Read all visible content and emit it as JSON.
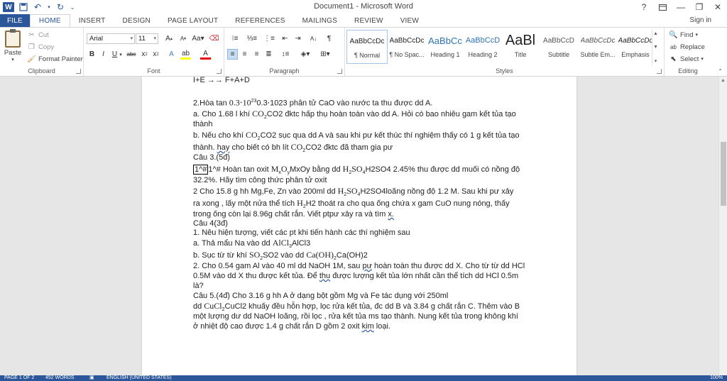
{
  "window": {
    "title": "Document1 - Microsoft Word",
    "help": "?",
    "sign_in": "Sign in"
  },
  "tabs": [
    "FILE",
    "HOME",
    "INSERT",
    "DESIGN",
    "PAGE LAYOUT",
    "REFERENCES",
    "MAILINGS",
    "REVIEW",
    "VIEW"
  ],
  "clipboard": {
    "paste": "Paste",
    "cut": "Cut",
    "copy": "Copy",
    "format_painter": "Format Painter",
    "label": "Clipboard"
  },
  "font": {
    "name": "Arial",
    "size": "11",
    "label": "Font"
  },
  "paragraph": {
    "label": "Paragraph"
  },
  "styles": {
    "label": "Styles",
    "items": [
      {
        "preview": "AaBbCcDc",
        "name": "¶ Normal"
      },
      {
        "preview": "AaBbCcDc",
        "name": "¶ No Spac..."
      },
      {
        "preview": "AaBbCc",
        "name": "Heading 1"
      },
      {
        "preview": "AaBbCcD",
        "name": "Heading 2"
      },
      {
        "preview": "AaBl",
        "name": "Title"
      },
      {
        "preview": "AaBbCcD",
        "name": "Subtitle"
      },
      {
        "preview": "AaBbCcDc",
        "name": "Subtle Em..."
      },
      {
        "preview": "AaBbCcDc",
        "name": "Emphasis"
      }
    ]
  },
  "editing": {
    "find": "Find",
    "replace": "Replace",
    "select": "Select",
    "label": "Editing"
  },
  "document": {
    "l1": "I+E →→ F+A+D",
    "l2a": "2.Hòa tan ",
    "l2m": "0.3⋅10",
    "l2s": "23",
    "l2b": "0.3⋅1023 phân tử CaO vào nước ta thu được dd A.",
    "l3a": "a. Cho 1.68 l khí ",
    "l3m": "CO",
    "l3s": "2",
    "l3b": "CO2 đktc hấp thụ hoàn toàn vào dd A. Hỏi có bao nhiêu gam kết tủa tạo",
    "l4": "thành",
    "l5a": "b. Nếu cho khí ",
    "l5m": "CO",
    "l5s": "2",
    "l5b": "CO2 sục qua dd A và sau khi pư kết thúc thí nghiệm thấy có 1 g kết tủa tạo",
    "l6a": "thành. ",
    "l6h": "hay",
    "l6b": " cho biết có bh lít ",
    "l6m": "CO",
    "l6s": "2",
    "l6c": "CO2 đktc đã tham gia pư",
    "l7": "Câu 3.(5đ)",
    "l8box": "1^#",
    "l8a": "1^# Hoàn tan oxit ",
    "l8m": "M",
    "l8s1": "x",
    "l8m2": "O",
    "l8s2": "y",
    "l8b": "MxOy bằng dd ",
    "l8m3": "H",
    "l8s3": "2",
    "l8m4": "SO",
    "l8s4": "4",
    "l8c": "H2SO4 2.45% thu được dd muối có nồng độ",
    "l9": "32.2%. Hãy tìm công thức phân tử oxit",
    "l10a": "2 Cho 15.8 g hh Mg,Fe, Zn vào 200ml dd ",
    "l10m": "H",
    "l10s": "2",
    "l10m2": "SO",
    "l10s2": "4",
    "l10b": "H2SO4loãng nồng độ 1.2 M. Sau khi pư xảy",
    "l11a": "ra xong , lấy một nửa thể tích ",
    "l11m": "H",
    "l11s": "2",
    "l11b": "H2 thoát ra cho qua ống chứa x gam CuO nung nóng, thấy",
    "l12a": "trong ống còn lại 8.96g chất rắn. Viết ptpư xảy ra và tìm ",
    "l12h": "x.",
    "l13": "Câu 4(3đ)",
    "l14": "1. Nêu hiện tượng, viết các pt khi tiến hành các thí nghiệm sau",
    "l15a": "a. Thả mẩu Na vào dd ",
    "l15m": "AlCl",
    "l15s": "3",
    "l15b": "AlCl3",
    "l16a": "b. Sục từ từ khí ",
    "l16m": "SO",
    "l16s": "2",
    "l16b": "SO2 vào dd ",
    "l16m2": "Ca(OH)",
    "l16s2": "2",
    "l16c": "Ca(OH)2",
    "l17a": "2. Cho 0.54 gam Al vào 40 ml dd NaOH 1M, sau ",
    "l17h": "pư",
    "l17b": " hoàn toàn thu được dd X. Cho từ từ dd HCl",
    "l18a": "0.5M vào dd X thu được kết tủa. Để ",
    "l18h": "thu",
    "l18b": " được lượng kết tủa lớn nhất cần thể tích dd HCl 0.5m",
    "l19": "là?",
    "l20": "Câu 5.(4đ) Cho 3.16 g hh A ở dạng bột gồm Mg và Fe tác dụng với 250ml",
    "l21a": "dd ",
    "l21m": "CuCl",
    "l21s": "2",
    "l21b": "CuCl2 khuấy đều hỗn hợp, lọc rửa kết tủa, đc dd B và 3.84 g chất rắn C. Thêm vào B",
    "l22": "một lượng dư dd NaOH loãng, rồi lọc , rửa kết tủa ms tạo thành. Nung kết tủa trong không khí",
    "l23a": "ở nhiệt độ cao được 1.4 g chất rắn D gồm 2 oxit ",
    "l23h": "kim",
    "l23b": " loại."
  },
  "status": {
    "page": "PAGE 1 OF 2",
    "words": "452 WORDS",
    "lang": "ENGLISH (UNITED STATES)",
    "zoom": "100%"
  },
  "colors": {
    "accent": "#2b579a"
  }
}
